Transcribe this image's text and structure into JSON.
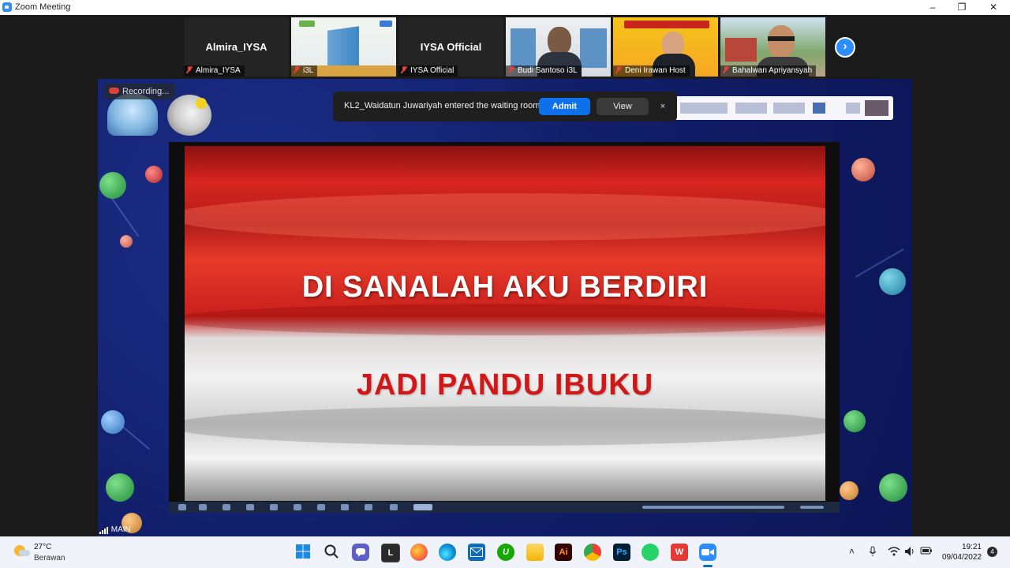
{
  "window": {
    "title": "Zoom Meeting"
  },
  "gallery": {
    "participants": [
      {
        "name": "Almira_IYSA",
        "display_label": "Almira_IYSA",
        "muted": true,
        "video": false
      },
      {
        "name": "i3L",
        "muted": true,
        "video": true
      },
      {
        "name": "IYSA Official",
        "display_label": "IYSA Official",
        "muted": true,
        "video": false
      },
      {
        "name": "Budi Santoso i3L",
        "muted": true,
        "video": true
      },
      {
        "name": "Deni Irawan Host",
        "muted": true,
        "video": true
      },
      {
        "name": "Bahalwan Apriyansyah",
        "muted": true,
        "video": true
      }
    ],
    "next_icon": "chevron-right-icon"
  },
  "share": {
    "recording_label": "Recording...",
    "notification": {
      "message": "KL2_Waidatun Juwariyah entered the waiting room",
      "admit_label": "Admit",
      "view_label": "View",
      "close_label": "×"
    },
    "video_text": {
      "line1": "DI SANALAH AKU BERDIRI",
      "line2": "JADI PANDU IBUKU"
    },
    "connection_label": "MAIN"
  },
  "taskbar": {
    "weather": {
      "temp": "27°C",
      "condition": "Berawan"
    },
    "apps": [
      "windows-start",
      "search",
      "teams-chat",
      "lark",
      "firefox",
      "edge",
      "mail",
      "upwork",
      "file-explorer",
      "illustrator",
      "chrome",
      "photoshop",
      "whatsapp",
      "wps",
      "zoom"
    ],
    "app_labels": {
      "lark": "L",
      "upwork": "U",
      "illustrator": "Ai",
      "photoshop": "Ps",
      "wps": "W"
    },
    "clock": {
      "time": "19:21",
      "date": "09/04/2022"
    },
    "notification_count": "4"
  },
  "colors": {
    "zoom_blue": "#2d8cff",
    "admit_blue": "#0e71eb",
    "mute_red": "#e0413a",
    "taskbar_bg": "#f0f3f9"
  }
}
